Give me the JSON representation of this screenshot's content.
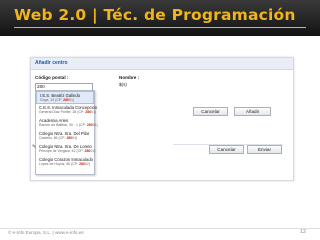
{
  "slide": {
    "title": "Web 2.0 | Téc. de Programación",
    "page_number": "12"
  },
  "footer": {
    "copyright": "© e-Info Europa, S.L. | www.e-info.es"
  },
  "form": {
    "header": "Añadir centro",
    "postal_label": "Código postal :",
    "postal_value": "280",
    "name_label": "Nombre :",
    "name_value": "$(s)",
    "cancel_label": "Cancelar",
    "add_label": "Añadir",
    "cancel2_label": "Cancelar",
    "send_label": "Enviar"
  },
  "suggestions": [
    {
      "name": "I.E.S. Beatriz Galindo",
      "addr": "Goya, 10 (CP: ",
      "cp": "280",
      "tail": "01)"
    },
    {
      "name": "C.E.S. Inmaculada Concepcion",
      "addr": "General Díaz Porlier, 28 (CP: ",
      "cp": "280",
      "tail": "01)"
    },
    {
      "name": "Academia Aries",
      "addr": "Ramón de Baltbar, 30 - 1 (CP: ",
      "cp": "280",
      "tail": "01)"
    },
    {
      "name": "Colegio Ntra. Sra. Del Pilar",
      "addr": "Castello, 56 (CP: ",
      "cp": "280",
      "tail": "01)"
    },
    {
      "name": "Colegio Ntra. Sra. De Loreto",
      "addr": "Principe de Vergara, 42 (CP: ",
      "cp": "280",
      "tail": "01)"
    },
    {
      "name": "Colegio Corazon Inmaculado",
      "addr": "Lopez de Hoyos, 56 (CP: ",
      "cp": "280",
      "tail": "02)"
    }
  ]
}
